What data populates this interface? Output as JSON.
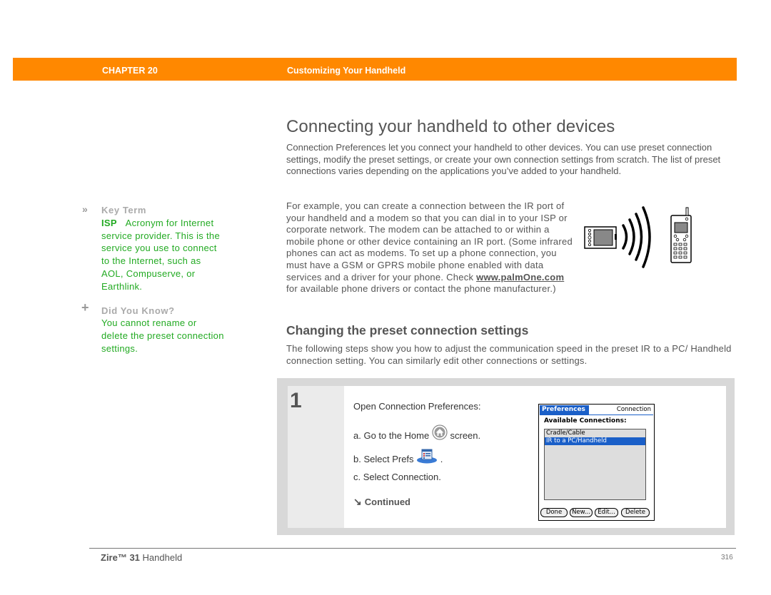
{
  "header": {
    "chapter": "CHAPTER 20",
    "section": "Customizing Your Handheld",
    "accent_color": "#ff8800"
  },
  "sidebar": {
    "key_term": {
      "icon": "double-chevron-icon",
      "heading": "Key Term",
      "term": "ISP",
      "definition": "Acronym for Internet service provider. This is the service you use to connect to the Internet, such as AOL, Compuserve, or Earthlink."
    },
    "did_you_know": {
      "icon": "plus-icon",
      "heading": "Did You Know?",
      "text": "You cannot rename or delete the preset connection settings."
    },
    "text_color": "#22aa22"
  },
  "main": {
    "title": "Connecting your handheld to other devices",
    "intro": "Connection Preferences let you connect your handheld to other devices. You can use preset connection settings, modify the preset settings, or create your own connection settings from scratch. The list of preset connections varies depending on the applications you’ve added to your handheld.",
    "example_before_link": "For example, you can create a connection between the IR port of your handheld and a modem so that you can dial in to your ISP or corporate network. The modem can be attached to or within a mobile phone or other device containing an IR port. (Some infrared phones can act as modems. To set up a phone connection, you must have a GSM or GPRS mobile phone enabled with data services and a driver for your phone. Check ",
    "example_link": "www.palmOne.com",
    "example_after_link": " for available phone drivers or contact the phone manufacturer.)",
    "illustration": "handheld-ir-to-phone-illustration",
    "subtitle": "Changing the preset connection settings",
    "subtitle_text": "The following steps show you how to adjust the communication speed in the preset IR to a PC/ Handheld connection setting. You can similarly edit other connections or settings."
  },
  "step": {
    "number": "1",
    "intro": "Open Connection Preferences:",
    "a_prefix": "a.  Go to the Home",
    "a_suffix": "screen.",
    "b_prefix": "b.  Select Prefs",
    "b_suffix": ".",
    "c": "c.  Select Connection.",
    "continued": "Continued",
    "home_icon": "home-icon",
    "prefs_icon": "prefs-icon"
  },
  "palm_screen": {
    "tab": "Preferences",
    "panel": "Connection",
    "label": "Available Connections:",
    "items": [
      {
        "label": "Cradle/Cable",
        "selected": false
      },
      {
        "label": "IR to a PC/Handheld",
        "selected": true
      }
    ],
    "buttons": [
      "Done",
      "New...",
      "Edit...",
      "Delete"
    ],
    "highlight_color": "#1a5fc8"
  },
  "footer": {
    "product_bold": "Zire™ 31",
    "product_rest": " Handheld",
    "page": "316"
  }
}
